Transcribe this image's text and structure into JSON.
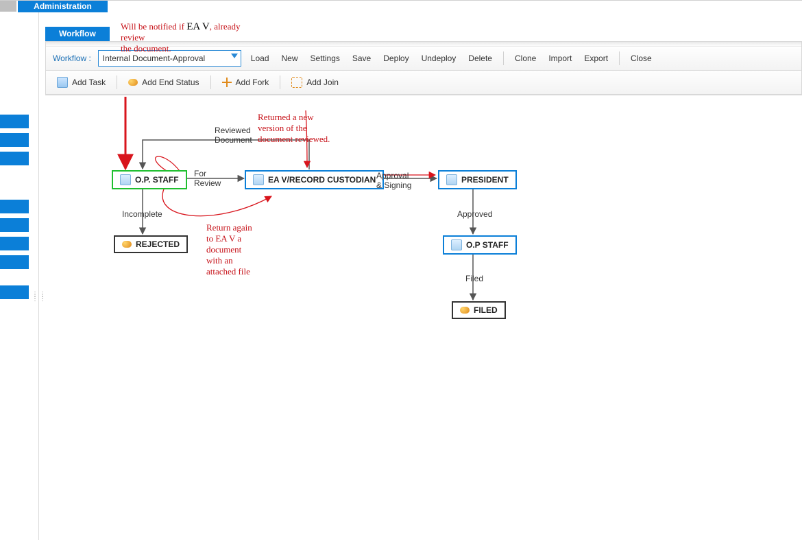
{
  "tabs": {
    "administration": "Administration",
    "workflow": "Workflow"
  },
  "toolbar1": {
    "workflow_label": "Workflow :",
    "workflow_value": "Internal Document-Approval",
    "load": "Load",
    "new": "New",
    "settings": "Settings",
    "save": "Save",
    "deploy": "Deploy",
    "undeploy": "Undeploy",
    "delete": "Delete",
    "clone": "Clone",
    "import": "Import",
    "export": "Export",
    "close": "Close"
  },
  "toolbar2": {
    "add_task": "Add Task",
    "add_end_status": "Add End Status",
    "add_fork": "Add Fork",
    "add_join": "Add Join"
  },
  "nodes": {
    "op_staff": "O.P. STAFF",
    "ea_v": "EA V/RECORD CUSTODIAN",
    "president": "PRESIDENT",
    "rejected": "REJECTED",
    "op_staff2": "O.P STAFF",
    "filed": "FILED"
  },
  "edges": {
    "for_review_1": "For",
    "for_review_2": "Review",
    "reviewed_1": "Reviewed",
    "reviewed_2": "Document",
    "approval_1": "Approval",
    "approval_2": "& Signing",
    "incomplete": "Incomplete",
    "approved": "Approved",
    "filed": "Filed"
  },
  "annotations": {
    "notify_1": "Will be notified if ",
    "notify_eav": "EA V",
    "notify_2": ", already review",
    "notify_3": "the document.",
    "returned_1": "Returned a new",
    "returned_2": "version of the",
    "returned_3": "document reviewed.",
    "return_again_1": "Return again",
    "return_again_2": "to EA V a",
    "return_again_3": "document",
    "return_again_4": "with an",
    "return_again_5": "attached file"
  }
}
